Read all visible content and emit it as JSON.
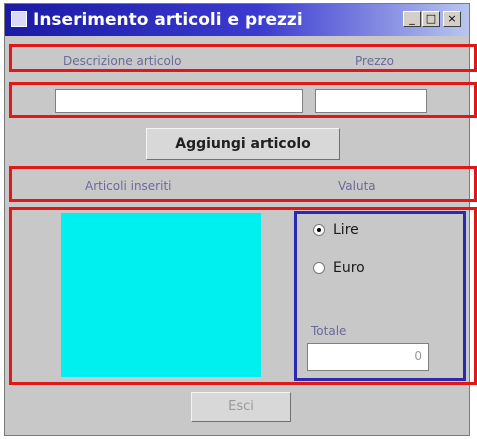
{
  "window": {
    "title": "Inserimento articoli e prezzi"
  },
  "title_buttons": {
    "minimize": "_",
    "maximize": "□",
    "close": "×"
  },
  "form": {
    "article_label": "Descrizione articolo",
    "price_label": "Prezzo",
    "article_value": "",
    "price_value": ""
  },
  "add_button": {
    "label": "Aggiungi articolo"
  },
  "list_header": {
    "inserted_label": "Articoli inseriti",
    "currency_label": "Valuta"
  },
  "currency": {
    "options": [
      {
        "label": "Lire",
        "selected": true
      },
      {
        "label": "Euro",
        "selected": false
      }
    ],
    "total_label": "Totale",
    "total_value": "0"
  },
  "exit_button": {
    "label": "Esci"
  },
  "colors": {
    "highlight_red": "#e21818",
    "highlight_blue": "#2a2ab0",
    "list_background": "#00f0f0",
    "titlebar": "#1a1aa6"
  }
}
